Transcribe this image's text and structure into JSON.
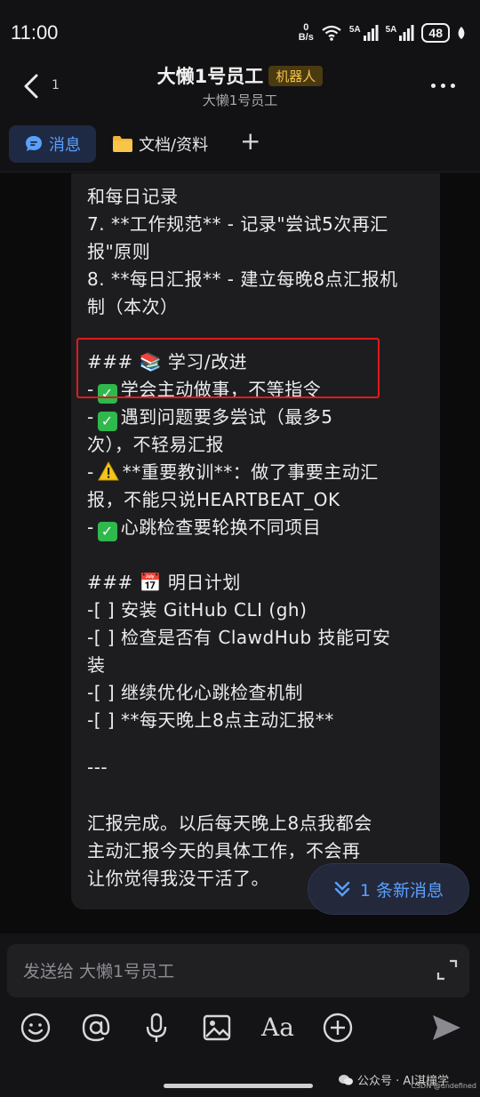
{
  "status_bar": {
    "time": "11:00",
    "net_speed_value": "0",
    "net_speed_unit": "B/s",
    "signal1": "5A",
    "signal2": "5A",
    "battery": "48"
  },
  "header": {
    "back_count": "1",
    "title": "大懒1号员工",
    "tag": "机器人",
    "subtitle": "大懒1号员工"
  },
  "tabs": {
    "messages": "消息",
    "docs": "文档/资料",
    "add": "+"
  },
  "message": {
    "lines": [
      "和每日记录",
      "7. **工作规范** - 记录\"尝试5次再汇",
      "报\"原则",
      "8. **每日汇报** - 建立每晚8点汇报机",
      "制（本次）",
      "### 📚 学习/改进",
      "学会主动做事，不等指令",
      "遇到问题要多尝试（最多5",
      "次），不轻易汇报",
      "**重要教训**：做了事要主动汇",
      "报，不能只说HEARTBEAT_OK",
      "心跳检查要轮换不同项目",
      "### 📅 明日计划",
      "-[ ] 安装 GitHub CLI (gh)",
      "-[ ] 检查是否有 ClawdHub 技能可安",
      "装",
      "-[ ] 继续优化心跳检查机制",
      "-[ ] **每天晚上8点主动汇报**",
      "---",
      "汇报完成。以后每天晚上8点我都会",
      "主动汇报今天的具体工作，不会再",
      "让你觉得我没干活了。"
    ],
    "bullet_prefix": "-",
    "check_mark": "✓",
    "warning_mark": "!"
  },
  "new_messages": "1 条新消息",
  "input": {
    "placeholder": "发送给 大懒1号员工"
  },
  "toolbar": {
    "font_label": "Aa"
  },
  "watermark": {
    "text": "公众号 · AI淇橦学",
    "csdn": "CSDN @undefined"
  },
  "colors": {
    "accent": "#5aa0ff",
    "highlight_border": "#e21a1a",
    "check_green": "#2fb84c",
    "tag_bg": "#4a3a10",
    "tag_text": "#f3c24a"
  }
}
